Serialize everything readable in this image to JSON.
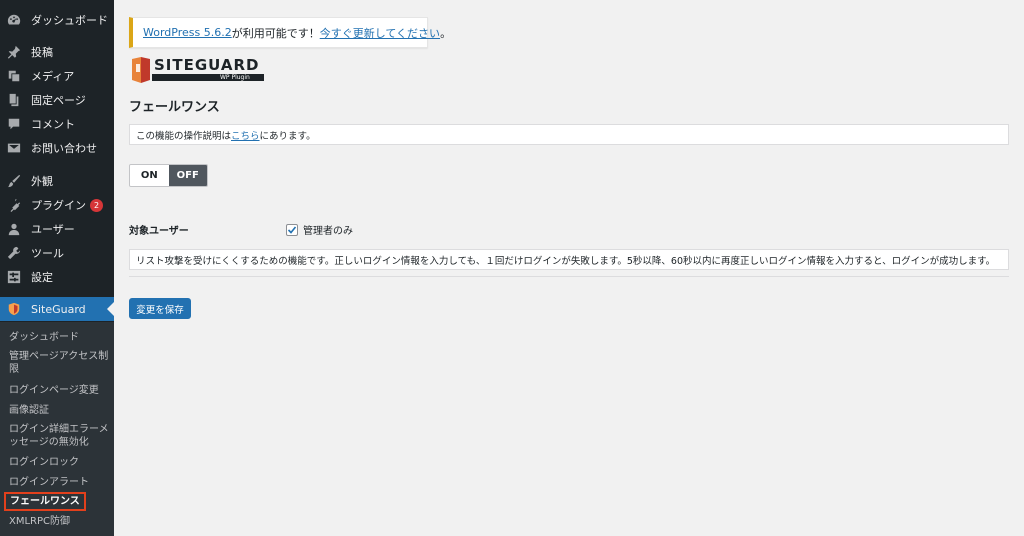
{
  "sidebar": {
    "items": [
      {
        "label": "ダッシュボード",
        "icon": "dashboard-icon"
      },
      {
        "label": "投稿",
        "icon": "pin-icon"
      },
      {
        "label": "メディア",
        "icon": "media-icon"
      },
      {
        "label": "固定ページ",
        "icon": "page-icon"
      },
      {
        "label": "コメント",
        "icon": "comment-icon"
      },
      {
        "label": "お問い合わせ",
        "icon": "mail-icon"
      },
      {
        "label": "外観",
        "icon": "brush-icon"
      },
      {
        "label": "プラグイン",
        "icon": "plugin-icon",
        "badge": "2"
      },
      {
        "label": "ユーザー",
        "icon": "user-icon"
      },
      {
        "label": "ツール",
        "icon": "wrench-icon"
      },
      {
        "label": "設定",
        "icon": "settings-icon"
      },
      {
        "label": "SiteGuard",
        "icon": "siteguard-icon",
        "active": true
      }
    ],
    "submenu": [
      "ダッシュボード",
      "管理ページアクセス制限",
      "ログインページ変更",
      "画像認証",
      "ログイン詳細エラーメッセージの無効化",
      "ログインロック",
      "ログインアラート",
      "フェールワンス",
      "XMLRPC防御"
    ]
  },
  "notice": {
    "link1": "WordPress 5.6.2",
    "middle": " が利用可能です！",
    "link2": "今すぐ更新してください",
    "end": "。"
  },
  "logo": {
    "brand": "SITEGUARD",
    "sub": "WP Plugin"
  },
  "page_title": "フェールワンス",
  "help": {
    "before": "この機能の操作説明は ",
    "link": "こちら",
    "after": " にあります。"
  },
  "toggle": {
    "on_label": "ON",
    "off_label": "OFF",
    "selected": "OFF"
  },
  "target": {
    "label": "対象ユーザー",
    "checkbox_label": "管理者のみ",
    "checked": true
  },
  "description": "リスト攻撃を受けにくくするための機能です。正しいログイン情報を入力しても、１回だけログインが失敗します。5秒以降、60秒以内に再度正しいログイン情報を入力すると、ログインが成功します。",
  "save_label": "変更を保存",
  "colors": {
    "accent": "#2271b1",
    "sidebar": "#1d2327",
    "badge": "#d63638",
    "highlight": "#e2401c"
  }
}
